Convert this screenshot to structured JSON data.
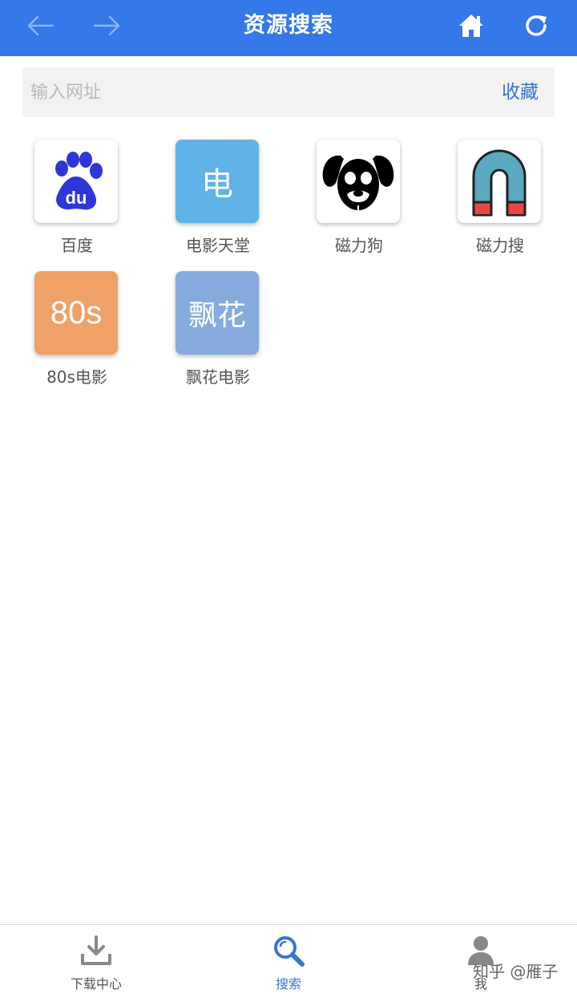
{
  "header": {
    "title": "资源搜索",
    "color": "#3478ea",
    "icons": [
      "back-arrow-icon",
      "forward-arrow-icon",
      "home-icon",
      "refresh-icon"
    ]
  },
  "url_bar": {
    "placeholder": "输入网址",
    "value": "",
    "favorite_label": "收藏"
  },
  "sites": [
    {
      "label": "百度",
      "icon": "baidu-paw-icon"
    },
    {
      "label": "电影天堂",
      "icon_text": "电",
      "color": "#5fb3e6"
    },
    {
      "label": "磁力狗",
      "icon": "dog-face-icon"
    },
    {
      "label": "磁力搜",
      "icon": "magnet-icon"
    },
    {
      "label": "80s电影",
      "icon_text": "80s",
      "color": "#f0a168"
    },
    {
      "label": "飘花电影",
      "icon_text": "飘花",
      "color": "#86abdd"
    }
  ],
  "tabbar": {
    "tabs": [
      {
        "label": "下载中心",
        "icon": "download-icon"
      },
      {
        "label": "搜索",
        "icon": "search-icon",
        "active": true
      },
      {
        "label": "我",
        "icon": "person-icon"
      }
    ],
    "accent": "#3575d4"
  },
  "watermark": "知乎 @雁子"
}
